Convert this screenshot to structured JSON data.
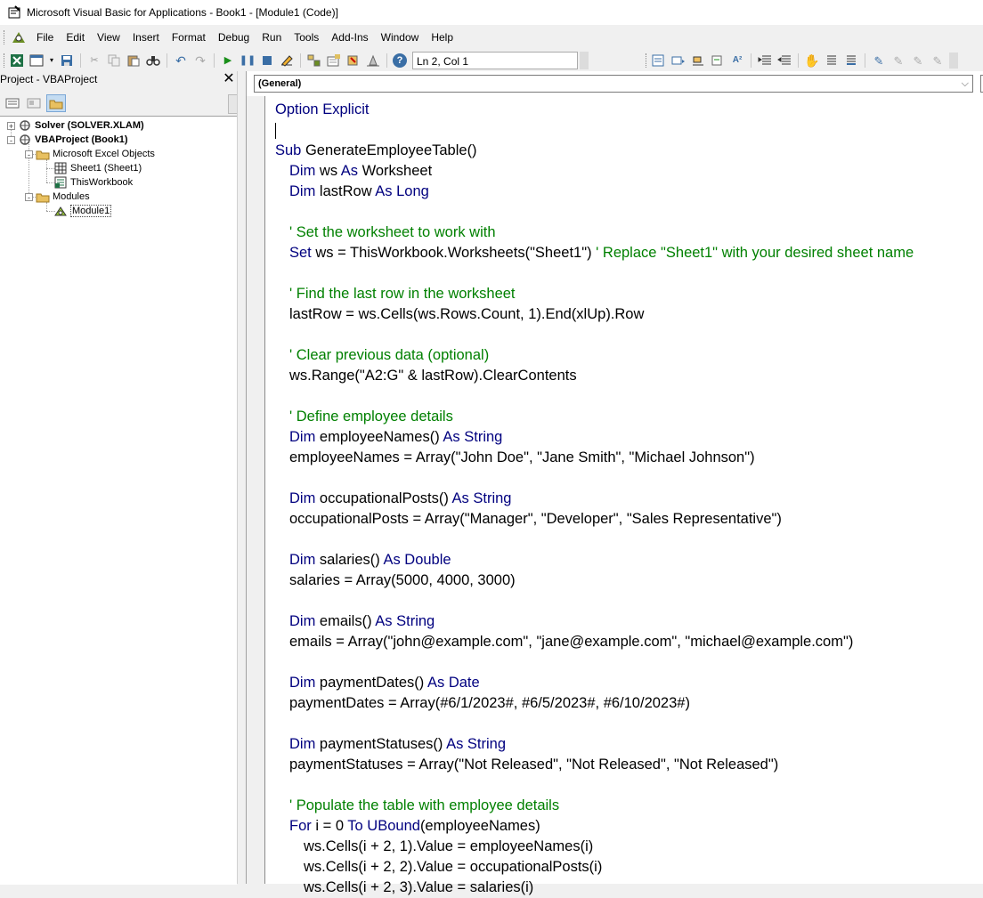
{
  "window": {
    "title": "Microsoft Visual Basic for Applications - Book1 - [Module1 (Code)]"
  },
  "menu": [
    "File",
    "Edit",
    "View",
    "Insert",
    "Format",
    "Debug",
    "Run",
    "Tools",
    "Add-Ins",
    "Window",
    "Help"
  ],
  "toolbar": {
    "status": "Ln 2, Col 1"
  },
  "project": {
    "title": "Project - VBAProject",
    "close": "✕",
    "tree": [
      {
        "label": "Solver (SOLVER.XLAM)",
        "bold": true,
        "icon": "vbaproject-icon",
        "expander": "+"
      },
      {
        "label": "VBAProject (Book1)",
        "bold": true,
        "icon": "vbaproject-icon",
        "expander": "-"
      },
      {
        "label": "Microsoft Excel Objects",
        "icon": "folder-icon",
        "expander": "-"
      },
      {
        "label": "Sheet1 (Sheet1)",
        "icon": "worksheet-icon"
      },
      {
        "label": "ThisWorkbook",
        "icon": "workbook-icon"
      },
      {
        "label": "Modules",
        "icon": "folder-icon",
        "expander": "-"
      },
      {
        "label": "Module1",
        "icon": "module-icon",
        "selected": true
      }
    ]
  },
  "editor": {
    "object_combo": "(General)"
  },
  "code_lines": [
    {
      "indent": 0,
      "parts": [
        [
          "k",
          "Option Explicit"
        ]
      ]
    },
    {
      "indent": 0,
      "cursor": true,
      "parts": []
    },
    {
      "indent": 0,
      "parts": [
        [
          "k",
          "Sub "
        ],
        [
          "t",
          "GenerateEmployeeTable()"
        ]
      ]
    },
    {
      "indent": 1,
      "parts": [
        [
          "k",
          "Dim "
        ],
        [
          "t",
          "ws "
        ],
        [
          "k",
          "As "
        ],
        [
          "t",
          "Worksheet"
        ]
      ]
    },
    {
      "indent": 1,
      "parts": [
        [
          "k",
          "Dim "
        ],
        [
          "t",
          "lastRow "
        ],
        [
          "k",
          "As Long"
        ]
      ]
    },
    {
      "indent": 0,
      "parts": []
    },
    {
      "indent": 1,
      "parts": [
        [
          "c",
          "' Set the worksheet to work with"
        ]
      ]
    },
    {
      "indent": 1,
      "parts": [
        [
          "k",
          "Set "
        ],
        [
          "t",
          "ws = ThisWorkbook.Worksheets(\"Sheet1\") "
        ],
        [
          "c",
          "' Replace \"Sheet1\" with your desired sheet name"
        ]
      ]
    },
    {
      "indent": 0,
      "parts": []
    },
    {
      "indent": 1,
      "parts": [
        [
          "c",
          "' Find the last row in the worksheet"
        ]
      ]
    },
    {
      "indent": 1,
      "parts": [
        [
          "t",
          "lastRow = ws.Cells(ws.Rows.Count, 1).End(xlUp).Row"
        ]
      ]
    },
    {
      "indent": 0,
      "parts": []
    },
    {
      "indent": 1,
      "parts": [
        [
          "c",
          "' Clear previous data (optional)"
        ]
      ]
    },
    {
      "indent": 1,
      "parts": [
        [
          "t",
          "ws.Range(\"A2:G\" & lastRow).ClearContents"
        ]
      ]
    },
    {
      "indent": 0,
      "parts": []
    },
    {
      "indent": 1,
      "parts": [
        [
          "c",
          "' Define employee details"
        ]
      ]
    },
    {
      "indent": 1,
      "parts": [
        [
          "k",
          "Dim "
        ],
        [
          "t",
          "employeeNames() "
        ],
        [
          "k",
          "As String"
        ]
      ]
    },
    {
      "indent": 1,
      "parts": [
        [
          "t",
          "employeeNames = Array(\"John Doe\", \"Jane Smith\", \"Michael Johnson\")"
        ]
      ]
    },
    {
      "indent": 0,
      "parts": []
    },
    {
      "indent": 1,
      "parts": [
        [
          "k",
          "Dim "
        ],
        [
          "t",
          "occupationalPosts() "
        ],
        [
          "k",
          "As String"
        ]
      ]
    },
    {
      "indent": 1,
      "parts": [
        [
          "t",
          "occupationalPosts = Array(\"Manager\", \"Developer\", \"Sales Representative\")"
        ]
      ]
    },
    {
      "indent": 0,
      "parts": []
    },
    {
      "indent": 1,
      "parts": [
        [
          "k",
          "Dim "
        ],
        [
          "t",
          "salaries() "
        ],
        [
          "k",
          "As Double"
        ]
      ]
    },
    {
      "indent": 1,
      "parts": [
        [
          "t",
          "salaries = Array(5000, 4000, 3000)"
        ]
      ]
    },
    {
      "indent": 0,
      "parts": []
    },
    {
      "indent": 1,
      "parts": [
        [
          "k",
          "Dim "
        ],
        [
          "t",
          "emails() "
        ],
        [
          "k",
          "As String"
        ]
      ]
    },
    {
      "indent": 1,
      "parts": [
        [
          "t",
          "emails = Array(\"john@example.com\", \"jane@example.com\", \"michael@example.com\")"
        ]
      ]
    },
    {
      "indent": 0,
      "parts": []
    },
    {
      "indent": 1,
      "parts": [
        [
          "k",
          "Dim "
        ],
        [
          "t",
          "paymentDates() "
        ],
        [
          "k",
          "As Date"
        ]
      ]
    },
    {
      "indent": 1,
      "parts": [
        [
          "t",
          "paymentDates = Array(#6/1/2023#, #6/5/2023#, #6/10/2023#)"
        ]
      ]
    },
    {
      "indent": 0,
      "parts": []
    },
    {
      "indent": 1,
      "parts": [
        [
          "k",
          "Dim "
        ],
        [
          "t",
          "paymentStatuses() "
        ],
        [
          "k",
          "As String"
        ]
      ]
    },
    {
      "indent": 1,
      "parts": [
        [
          "t",
          "paymentStatuses = Array(\"Not Released\", \"Not Released\", \"Not Released\")"
        ]
      ]
    },
    {
      "indent": 0,
      "parts": []
    },
    {
      "indent": 1,
      "parts": [
        [
          "c",
          "' Populate the table with employee details"
        ]
      ]
    },
    {
      "indent": 1,
      "parts": [
        [
          "k",
          "For "
        ],
        [
          "t",
          "i = 0 "
        ],
        [
          "k",
          "To "
        ],
        [
          "k",
          "UBound"
        ],
        [
          "t",
          "(employeeNames)"
        ]
      ]
    },
    {
      "indent": 2,
      "parts": [
        [
          "t",
          "ws.Cells(i + 2, 1).Value = employeeNames(i)"
        ]
      ]
    },
    {
      "indent": 2,
      "parts": [
        [
          "t",
          "ws.Cells(i + 2, 2).Value = occupationalPosts(i)"
        ]
      ]
    },
    {
      "indent": 2,
      "parts": [
        [
          "t",
          "ws.Cells(i + 2, 3).Value = salaries(i)"
        ]
      ]
    }
  ]
}
